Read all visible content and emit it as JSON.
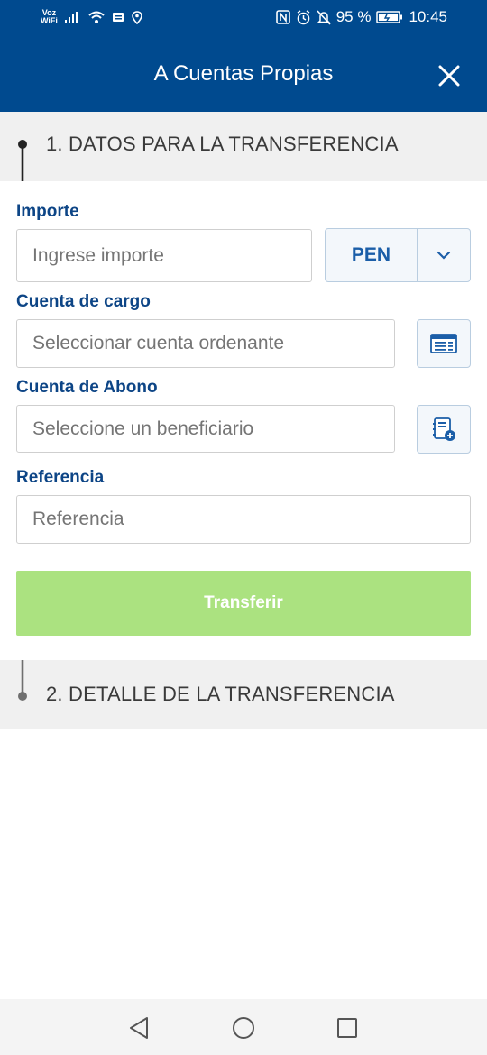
{
  "status_bar": {
    "voz_label": "Voz",
    "wifi_label": "WiFi",
    "battery": "95 %",
    "time": "10:45"
  },
  "header": {
    "title": "A Cuentas Propias"
  },
  "step1": {
    "title": "1. DATOS PARA LA TRANSFERENCIA"
  },
  "form": {
    "importe_label": "Importe",
    "importe_placeholder": "Ingrese importe",
    "currency": "PEN",
    "cargo_label": "Cuenta de cargo",
    "cargo_placeholder": "Seleccionar cuenta ordenante",
    "abono_label": "Cuenta de Abono",
    "abono_placeholder": "Seleccione un beneficiario",
    "referencia_label": "Referencia",
    "referencia_placeholder": "Referencia",
    "submit_label": "Transferir"
  },
  "step2": {
    "title": "2. DETALLE DE LA TRANSFERENCIA"
  },
  "nav": {
    "icons": [
      "back-icon",
      "home-icon",
      "recents-icon"
    ]
  },
  "colors": {
    "brand": "#004a8f",
    "label": "#0d4586",
    "accent": "#1b5ea8",
    "button_disabled": "#abe280"
  }
}
